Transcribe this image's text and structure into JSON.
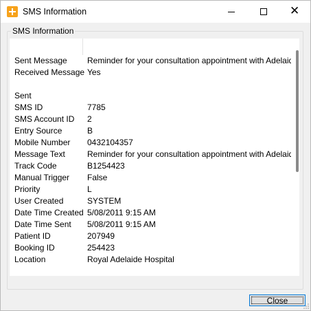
{
  "window": {
    "title": "SMS Information"
  },
  "group": {
    "legend": "SMS Information"
  },
  "rows": [
    {
      "label": "Sent Message",
      "value": "Reminder for your consultation appointment with Adelaide Cardi"
    },
    {
      "label": "Received Message",
      "value": "Yes"
    },
    {
      "label": "Sent",
      "value": ""
    },
    {
      "label": "SMS ID",
      "value": "7785"
    },
    {
      "label": "SMS Account ID",
      "value": "2"
    },
    {
      "label": "Entry Source",
      "value": "B"
    },
    {
      "label": "Mobile Number",
      "value": "0432104357"
    },
    {
      "label": "Message Text",
      "value": "Reminder for your consultation appointment with Adelaide Cardi"
    },
    {
      "label": "Track Code",
      "value": "B1254423"
    },
    {
      "label": "Manual Trigger",
      "value": "False"
    },
    {
      "label": "Priority",
      "value": "L"
    },
    {
      "label": "User Created",
      "value": "SYSTEM"
    },
    {
      "label": "Date Time Created",
      "value": "5/08/2011  9:15 AM"
    },
    {
      "label": "Date Time Sent",
      "value": "5/08/2011  9:15 AM"
    },
    {
      "label": "Patient ID",
      "value": "207949"
    },
    {
      "label": "Booking ID",
      "value": "254423"
    },
    {
      "label": "Location",
      "value": "Royal Adelaide Hospital"
    }
  ],
  "buttons": {
    "close": "Close"
  }
}
